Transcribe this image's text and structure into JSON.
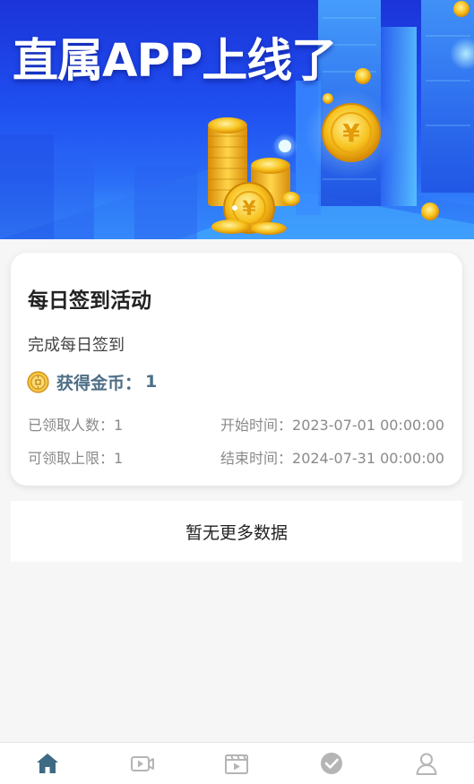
{
  "banner": {
    "title": "直属APP上线了"
  },
  "activity": {
    "title": "每日签到活动",
    "description": "完成每日签到",
    "reward_label": "获得金币：",
    "reward_value": "1",
    "claimed_label": "已领取人数：",
    "claimed_value": "1",
    "limit_label": "可领取上限：",
    "limit_value": "1",
    "start_label": "开始时间：",
    "start_value": "2023-07-01 00:00:00",
    "end_label": "结束时间：",
    "end_value": "2024-07-31 00:00:00"
  },
  "list": {
    "no_more_text": "暂无更多数据"
  },
  "tabbar": {
    "active_color": "#3d6b83",
    "inactive_color": "#b5b5b5",
    "tabs": [
      {
        "icon": "home-icon",
        "active": true
      },
      {
        "icon": "video-icon",
        "active": false
      },
      {
        "icon": "clapperboard-icon",
        "active": false
      },
      {
        "icon": "checkmark-icon",
        "active": false
      },
      {
        "icon": "profile-icon",
        "active": false
      }
    ]
  }
}
